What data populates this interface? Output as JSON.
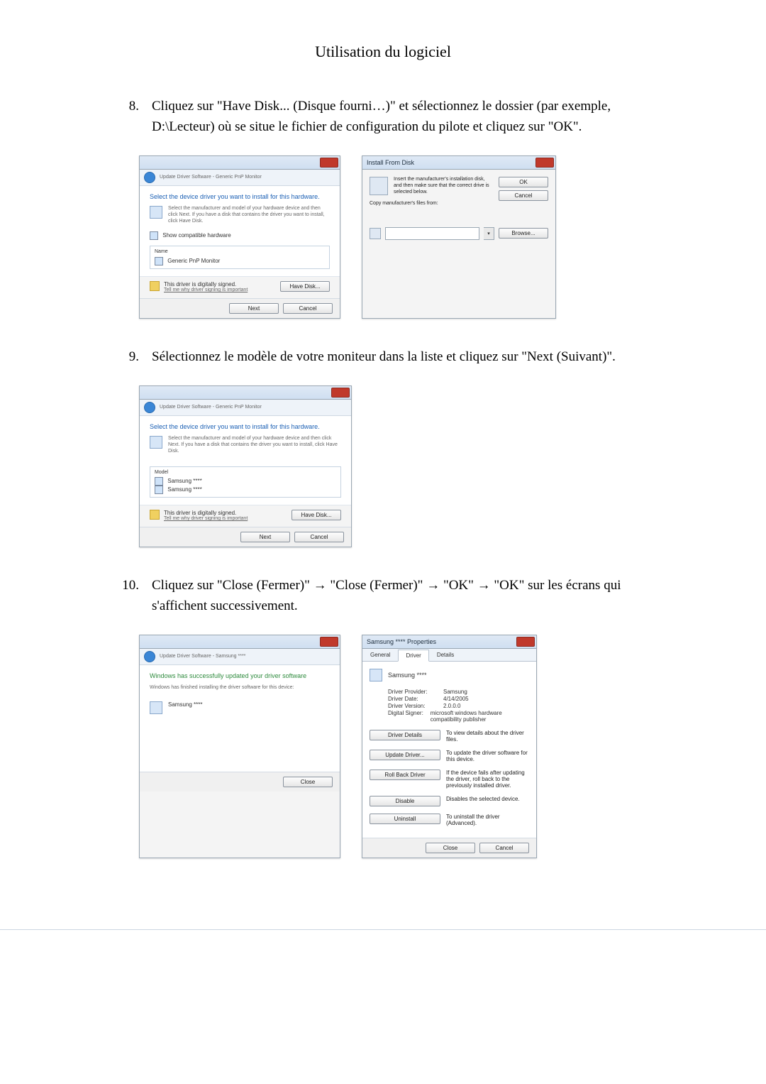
{
  "header": "Utilisation du logiciel",
  "steps": [
    {
      "n": "8.",
      "text": "Cliquez sur \"Have Disk... (Disque fourni…)\" et sélectionnez le dossier (par exemple, D:\\Lecteur) où se situe le fichier de configuration du pilote et cliquez sur \"OK\"."
    },
    {
      "n": "9.",
      "text": "Sélectionnez le modèle de votre moniteur dans la liste et cliquez sur \"Next (Suivant)\"."
    },
    {
      "n": "10.",
      "text": "Cliquez sur \"Close (Fermer)\" → \"Close (Fermer)\" → \"OK\" → \"OK\" sur les écrans qui s'affichent successivement."
    }
  ],
  "wiz1": {
    "crumbs": "Update Driver Software - Generic PnP Monitor",
    "title": "Select the device driver you want to install for this hardware.",
    "hint": "Select the manufacturer and model of your hardware device and then click Next. If you have a disk that contains the driver you want to install, click Have Disk.",
    "show_compat": "Show compatible hardware",
    "col": "Name",
    "item": "Generic PnP Monitor",
    "signed": "This driver is digitally signed.",
    "why": "Tell me why driver signing is important",
    "have_disk": "Have Disk...",
    "next": "Next",
    "cancel": "Cancel"
  },
  "ifd": {
    "title": "Install From Disk",
    "msg": "Insert the manufacturer's installation disk, and then make sure that the correct drive is selected below.",
    "ok": "OK",
    "cancel": "Cancel",
    "copy": "Copy manufacturer's files from:",
    "browse": "Browse..."
  },
  "wiz2": {
    "crumbs": "Update Driver Software - Generic PnP Monitor",
    "title": "Select the device driver you want to install for this hardware.",
    "hint": "Select the manufacturer and model of your hardware device and then click Next. If you have a disk that contains the driver you want to install, click Have Disk.",
    "col": "Model",
    "item1": "Samsung ****",
    "item2": "Samsung ****",
    "signed": "This driver is digitally signed.",
    "why": "Tell me why driver signing is important",
    "have_disk": "Have Disk...",
    "next": "Next",
    "cancel": "Cancel"
  },
  "wiz3": {
    "crumbs": "Update Driver Software - Samsung ****",
    "title": "Windows has successfully updated your driver software",
    "hint": "Windows has finished installing the driver software for this device:",
    "device": "Samsung ****",
    "close": "Close"
  },
  "props": {
    "title": "Samsung **** Properties",
    "tabs": [
      "General",
      "Driver",
      "Details"
    ],
    "device": "Samsung ****",
    "kv": [
      {
        "k": "Driver Provider:",
        "v": "Samsung"
      },
      {
        "k": "Driver Date:",
        "v": "4/14/2005"
      },
      {
        "k": "Driver Version:",
        "v": "2.0.0.0"
      },
      {
        "k": "Digital Signer:",
        "v": "microsoft windows hardware compatibility publisher"
      }
    ],
    "actions": [
      {
        "b": "Driver Details",
        "d": "To view details about the driver files."
      },
      {
        "b": "Update Driver...",
        "d": "To update the driver software for this device."
      },
      {
        "b": "Roll Back Driver",
        "d": "If the device fails after updating the driver, roll back to the previously installed driver."
      },
      {
        "b": "Disable",
        "d": "Disables the selected device."
      },
      {
        "b": "Uninstall",
        "d": "To uninstall the driver (Advanced)."
      }
    ],
    "close": "Close",
    "cancel": "Cancel"
  }
}
